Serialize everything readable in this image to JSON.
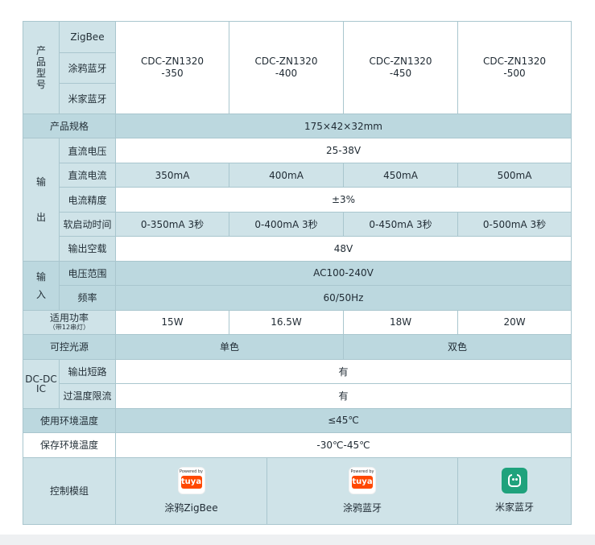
{
  "labels": {
    "model_group": "产品型号",
    "zigbee": "ZigBee",
    "tuya_bt": "涂鸦蓝牙",
    "mi_bt": "米家蓝牙",
    "spec": "产品规格",
    "output_group_top": "输",
    "output_group_bottom": "出",
    "dc_voltage": "直流电压",
    "dc_current": "直流电流",
    "current_accuracy": "电流精度",
    "soft_start": "软启动时间",
    "output_no_load": "输出空载",
    "input_group_top": "输",
    "input_group_bottom": "入",
    "voltage_range": "电压范围",
    "frequency": "频率",
    "power": "适用功率",
    "power_note": "（带12串灯）",
    "light_source": "可控光源",
    "dcdc_ic_top": "DC-DC",
    "dcdc_ic_bottom": "IC",
    "output_short": "输出短路",
    "overtemp_limit": "过温度限流",
    "operating_temp": "使用环境温度",
    "storage_temp": "保存环境温度",
    "control_module": "控制模组"
  },
  "models": [
    "CDC-ZN1320\n-350",
    "CDC-ZN1320\n-400",
    "CDC-ZN1320\n-450",
    "CDC-ZN1320\n-500"
  ],
  "values": {
    "spec": "175×42×32mm",
    "dc_voltage": "25-38V",
    "dc_current": [
      "350mA",
      "400mA",
      "450mA",
      "500mA"
    ],
    "current_accuracy": "±3%",
    "soft_start": [
      "0-350mA 3秒",
      "0-400mA 3秒",
      "0-450mA 3秒",
      "0-500mA 3秒"
    ],
    "output_no_load": "48V",
    "voltage_range": "AC100-240V",
    "frequency": "60/50Hz",
    "power": [
      "15W",
      "16.5W",
      "18W",
      "20W"
    ],
    "light_source": [
      "单色",
      "双色"
    ],
    "output_short": "有",
    "overtemp_limit": "有",
    "operating_temp": "≤45℃",
    "storage_temp": "-30℃-45℃"
  },
  "modules": [
    {
      "icon": "tuya-logo-icon",
      "badge_top": "Powered by",
      "badge_brand": "tuya",
      "label": "涂鸦ZigBee"
    },
    {
      "icon": "tuya-logo-icon",
      "badge_top": "Powered by",
      "badge_brand": "tuya",
      "label": "涂鸦蓝牙"
    },
    {
      "icon": "mi-home-logo-icon",
      "label": "米家蓝牙"
    }
  ],
  "colors": {
    "band_dark": "#bcd8df",
    "band_light": "#cfe3e8",
    "border": "#a9c6ce",
    "tuya_orange": "#ff4800",
    "mi_green": "#1fa27c"
  }
}
